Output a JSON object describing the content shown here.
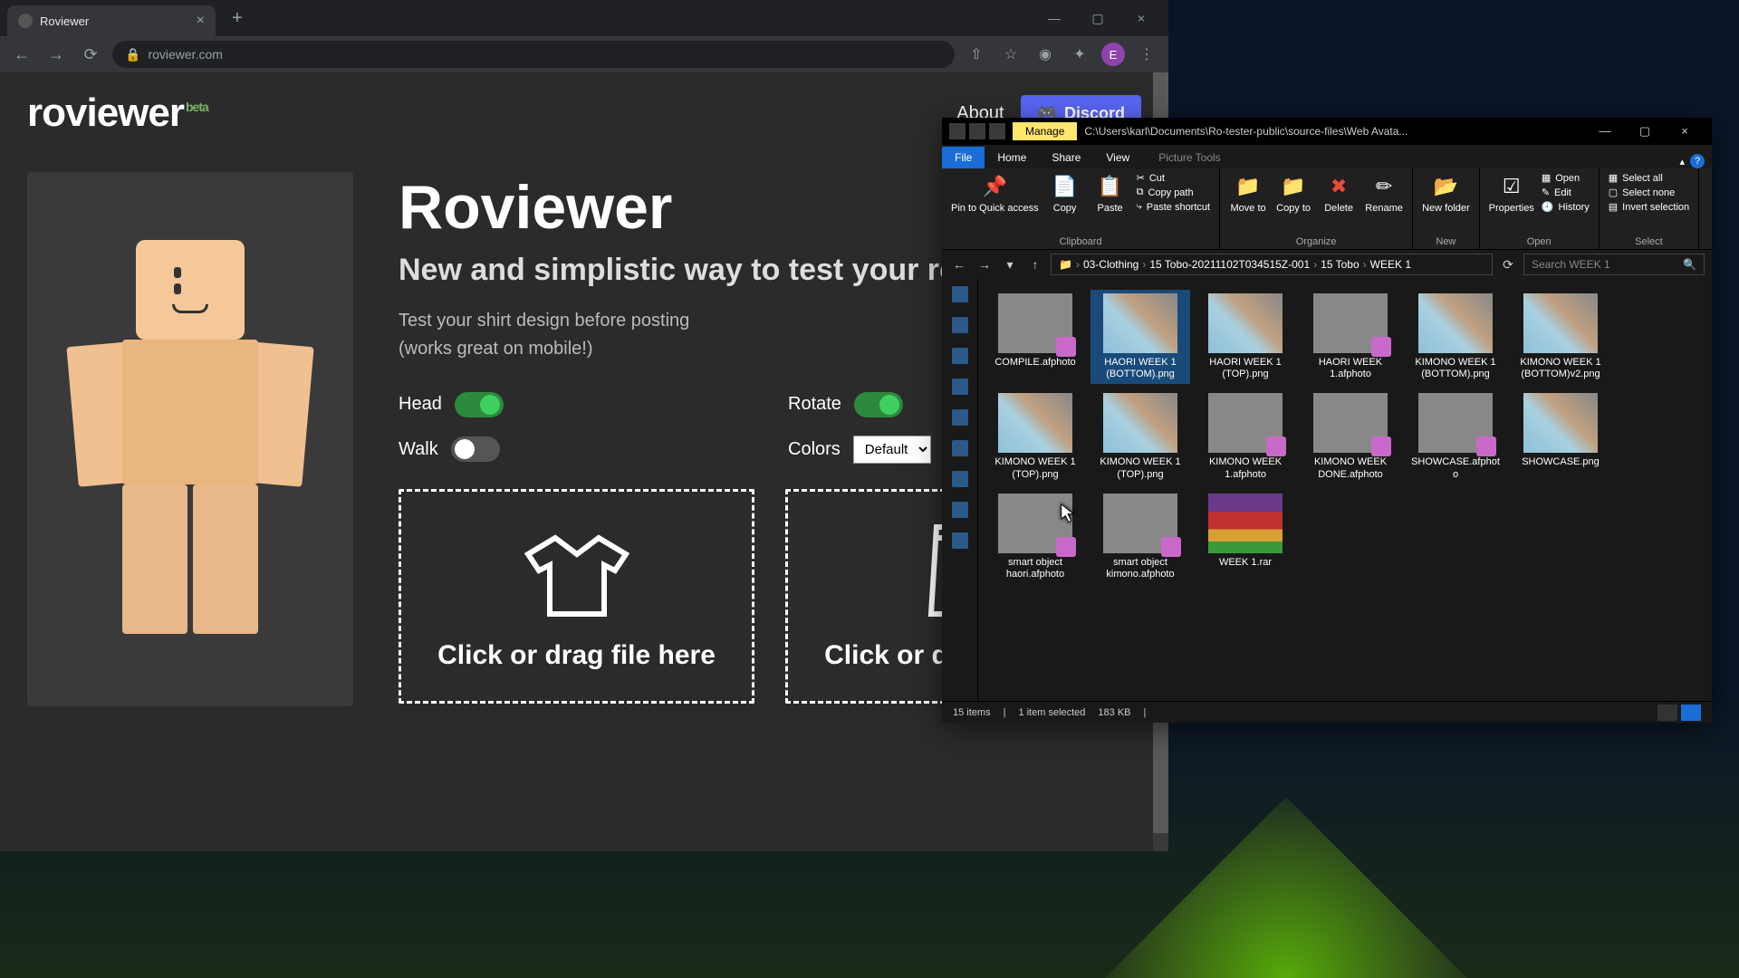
{
  "browser": {
    "tab_title": "Roviewer",
    "url": "roviewer.com",
    "profile_letter": "E"
  },
  "page": {
    "logo": "roviewer",
    "logo_badge": "beta",
    "about": "About",
    "discord": "Discord",
    "title": "Roviewer",
    "subtitle": "New and simplistic way to test your roblox shirts",
    "desc1": "Test your shirt design before posting",
    "desc2": "(works great on mobile!)",
    "toggles": {
      "head": "Head",
      "rotate": "Rotate",
      "walk": "Walk",
      "colors": "Colors",
      "colors_value": "Default"
    },
    "drop_shirt": "Click or drag file here",
    "drop_pants": "Click or drag file here"
  },
  "explorer": {
    "title_path": "C:\\Users\\karl\\Documents\\Ro-tester-public\\source-files\\Web Avata...",
    "manage": "Manage",
    "menu": {
      "file": "File",
      "home": "Home",
      "share": "Share",
      "view": "View",
      "pt": "Picture Tools"
    },
    "ribbon": {
      "pin": "Pin to Quick access",
      "copy": "Copy",
      "paste": "Paste",
      "cut": "Cut",
      "copy_path": "Copy path",
      "paste_shortcut": "Paste shortcut",
      "move": "Move to",
      "copy_to": "Copy to",
      "delete": "Delete",
      "rename": "Rename",
      "new_folder": "New folder",
      "properties": "Properties",
      "open": "Open",
      "edit": "Edit",
      "history": "History",
      "select_all": "Select all",
      "select_none": "Select none",
      "invert": "Invert selection",
      "g_clipboard": "Clipboard",
      "g_organize": "Organize",
      "g_new": "New",
      "g_open": "Open",
      "g_select": "Select"
    },
    "breadcrumb": [
      "03-Clothing",
      "15 Tobo-20211102T034515Z-001",
      "15 Tobo",
      "WEEK 1"
    ],
    "search_placeholder": "Search WEEK 1",
    "files": [
      {
        "name": "COMPILE.afphoto",
        "kind": "af"
      },
      {
        "name": "HAORI WEEK 1 (BOTTOM).png",
        "kind": "template",
        "selected": true
      },
      {
        "name": "HAORI WEEK 1 (TOP).png",
        "kind": "template"
      },
      {
        "name": "HAORI WEEK 1.afphoto",
        "kind": "af"
      },
      {
        "name": "KIMONO WEEK 1 (BOTTOM).png",
        "kind": "template"
      },
      {
        "name": "KIMONO WEEK 1 (BOTTOM)v2.png",
        "kind": "template"
      },
      {
        "name": "KIMONO WEEK 1 (TOP).png",
        "kind": "template"
      },
      {
        "name": "KIMONO WEEK 1 (TOP).png",
        "kind": "template"
      },
      {
        "name": "KIMONO WEEK 1.afphoto",
        "kind": "af"
      },
      {
        "name": "KIMONO WEEK DONE.afphoto",
        "kind": "af"
      },
      {
        "name": "SHOWCASE.afphoto",
        "kind": "af"
      },
      {
        "name": "SHOWCASE.png",
        "kind": "template"
      },
      {
        "name": "smart object haori.afphoto",
        "kind": "af"
      },
      {
        "name": "smart object kimono.afphoto",
        "kind": "af"
      },
      {
        "name": "WEEK 1.rar",
        "kind": "rar"
      }
    ],
    "status": {
      "items": "15 items",
      "selected": "1 item selected",
      "size": "183 KB"
    }
  }
}
